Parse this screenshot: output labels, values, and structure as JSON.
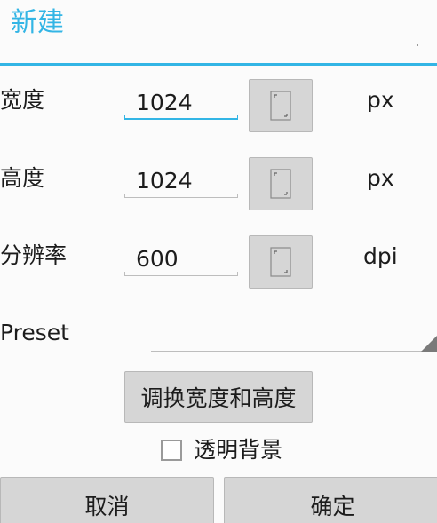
{
  "dialog": {
    "title": "新建"
  },
  "rows": [
    {
      "label": "宽度",
      "value": "1024",
      "unit": "px",
      "icon": "page-size-icon"
    },
    {
      "label": "高度",
      "value": "1024",
      "unit": "px",
      "icon": "page-size-icon"
    },
    {
      "label": "分辨率",
      "value": "600",
      "unit": "dpi",
      "icon": "page-size-icon"
    }
  ],
  "preset": {
    "label": "Preset",
    "value": ""
  },
  "swap_button": {
    "label": "调换宽度和高度"
  },
  "transparent": {
    "label": "透明背景",
    "checked": false
  },
  "buttons": {
    "cancel": "取消",
    "ok": "确定"
  },
  "colors": {
    "accent": "#33b5e5",
    "button_bg": "#d6d6d6"
  }
}
